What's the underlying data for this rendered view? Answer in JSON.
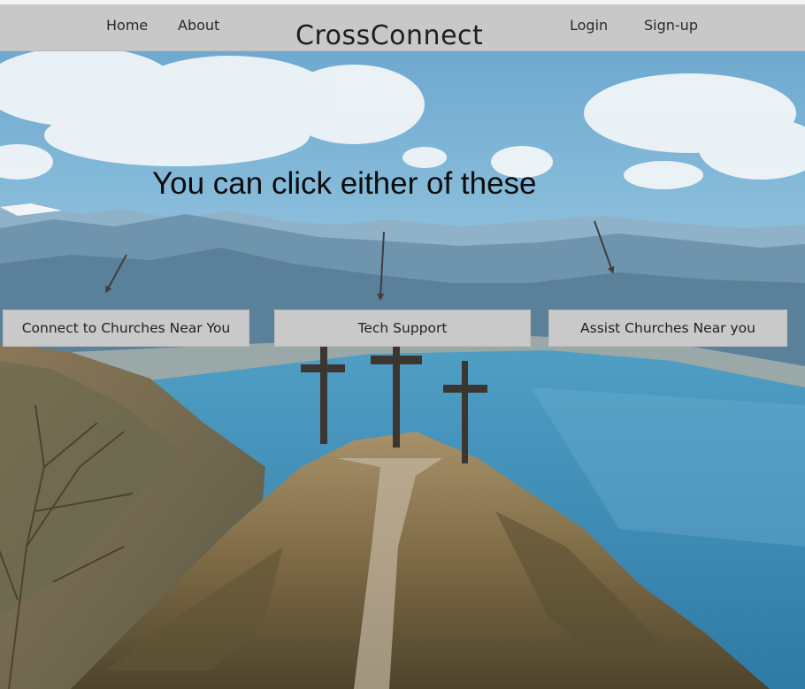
{
  "nav": {
    "home": "Home",
    "about": "About",
    "brand": "CrossConnect",
    "login": "Login",
    "signup": "Sign-up"
  },
  "hero": {
    "headline": "You can click either of these",
    "buttons": [
      {
        "label": "Connect to Churches Near You"
      },
      {
        "label": "Tech Support"
      },
      {
        "label": "Assist Churches Near you"
      }
    ]
  },
  "colors": {
    "nav_bg": "#c8c8c8",
    "button_bg": "#c9c9c9",
    "sky": "#8ec3de",
    "lake": "#3d8eb5"
  }
}
